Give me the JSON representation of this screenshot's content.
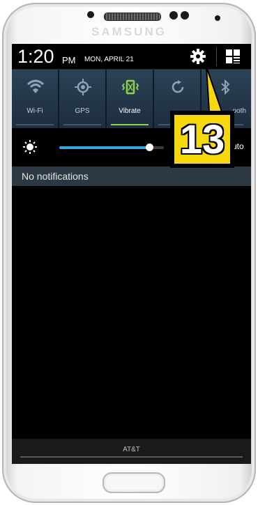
{
  "device": {
    "brand": "SAMSUNG"
  },
  "statusbar": {
    "time": "1:20",
    "ampm": "PM",
    "date": "MON, APRIL 21",
    "icons": [
      "settings-gear-icon",
      "quick-settings-grid-icon"
    ]
  },
  "quick_settings": {
    "tiles": [
      {
        "label": "Wi-Fi",
        "icon": "wifi-icon",
        "active": false
      },
      {
        "label": "GPS",
        "icon": "gps-icon",
        "active": false
      },
      {
        "label": "Vibrate",
        "icon": "vibrate-icon",
        "active": true
      },
      {
        "label": "",
        "icon": "screen-rotation-icon",
        "active": false
      },
      {
        "label": "ooth",
        "icon": "bluetooth-icon",
        "active": false
      }
    ],
    "active_color": "#8ed34a"
  },
  "brightness": {
    "icon": "brightness-icon",
    "level": 0.86,
    "auto_label": "uto",
    "accent": "#37a3dc"
  },
  "notifications": {
    "header": "No notifications"
  },
  "carrier": {
    "name": "AT&T"
  },
  "callout": {
    "number": "13",
    "color": "#f5d90e"
  }
}
